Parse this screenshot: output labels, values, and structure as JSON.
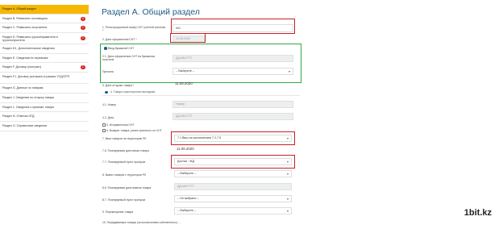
{
  "sidebar": {
    "items": [
      {
        "label": "Раздел А. Общий раздел",
        "badge": ""
      },
      {
        "label": "Раздел В. Реквизиты поставщика",
        "badge": "4"
      },
      {
        "label": "Раздел С. Реквизиты получателя",
        "badge": "1"
      },
      {
        "label": "Раздел D. Реквизиты грузоотправителя и грузополучателя",
        "badge": "2"
      },
      {
        "label": "Раздел D1. Дополнительные сведения",
        "badge": ""
      },
      {
        "label": "Раздел E. Сведения по перевозке",
        "badge": ""
      },
      {
        "label": "Раздел F. Договор (контракт)",
        "badge": "2"
      },
      {
        "label": "Раздел F1. Договор (контракт) в рамках УСД/СРП",
        "badge": ""
      },
      {
        "label": "Раздел G. Данные по товарам",
        "badge": ""
      },
      {
        "label": "Раздел J. Сведения по отпуску товара",
        "badge": ""
      },
      {
        "label": "Раздел L. Сведения о приемке товара",
        "badge": ""
      },
      {
        "label": "Раздел N. Отметка ОГД",
        "badge": ""
      },
      {
        "label": "Раздел О. Справочные сведения",
        "badge": ""
      }
    ]
  },
  "form": {
    "title": "Раздел А. Общий раздел",
    "reg_number_label": "1. Регистрационный номер СНТ учетной системы *",
    "reg_number_value": "001",
    "date_label": "2. Дата оформления СНТ *",
    "date_value": "10.06.2020",
    "paper_snt_label": "Ввод бумажной СНТ",
    "paper_date_label": "2.1. Дата оформления СНТ на бумажном носителе",
    "paper_date_placeholder": "ДД.ММ.ГГГГ",
    "reason_label": "Причина",
    "reason_value": "-- Выберите --",
    "ship_date_label": "3. Дата отгрузки товара *",
    "ship_date_value": "11.06.2020",
    "waybill_label": "4. Товаро-транспортная накладная",
    "number_label": "4.1. Номер",
    "number_placeholder": "Номер",
    "date2_label": "4.2. Дата",
    "date2_placeholder": "ДД.ММ.ГГГГ",
    "check1_label": "5. Исправленная СНТ",
    "check2_label": "6. Возврат товара, ранее принятого по СНТ",
    "import_label": "7. Ввоз товаров на территорию РК",
    "import_value": "7.1 Ввоз за исключением 7.2-7.5",
    "planned_import_date_label": "7.6. Планируемая дата ввоза товара",
    "planned_import_date_value": "11.06.2020",
    "checkpoint_label": "7.7. Планируемый пункт пропуска",
    "checkpoint_value": "Достык - ЖД",
    "export_label": "8. Вывоз товаров с территории РК",
    "export_value": "-- Выберите --",
    "planned_export_date_label": "8.6. Планируемая дата вывоза товара",
    "planned_export_date_placeholder": "ДД.ММ.ГГГГ",
    "export_checkpoint_label": "8.7. Планируемый пункт пропуска",
    "export_checkpoint_value": "-- Не выбрано --",
    "movement_label": "9. Перемещение товара",
    "movement_value": "-- Выберите --",
    "transfer_label": "10. Передаваемые товары (за исключением собственного) ..."
  },
  "watermark": "1bit.kz",
  "colors": {
    "accent": "#f5b700",
    "title": "#1f5b85",
    "highlight_red": "#c8202a",
    "highlight_green": "#2ea84a",
    "badge": "#d9261c"
  }
}
